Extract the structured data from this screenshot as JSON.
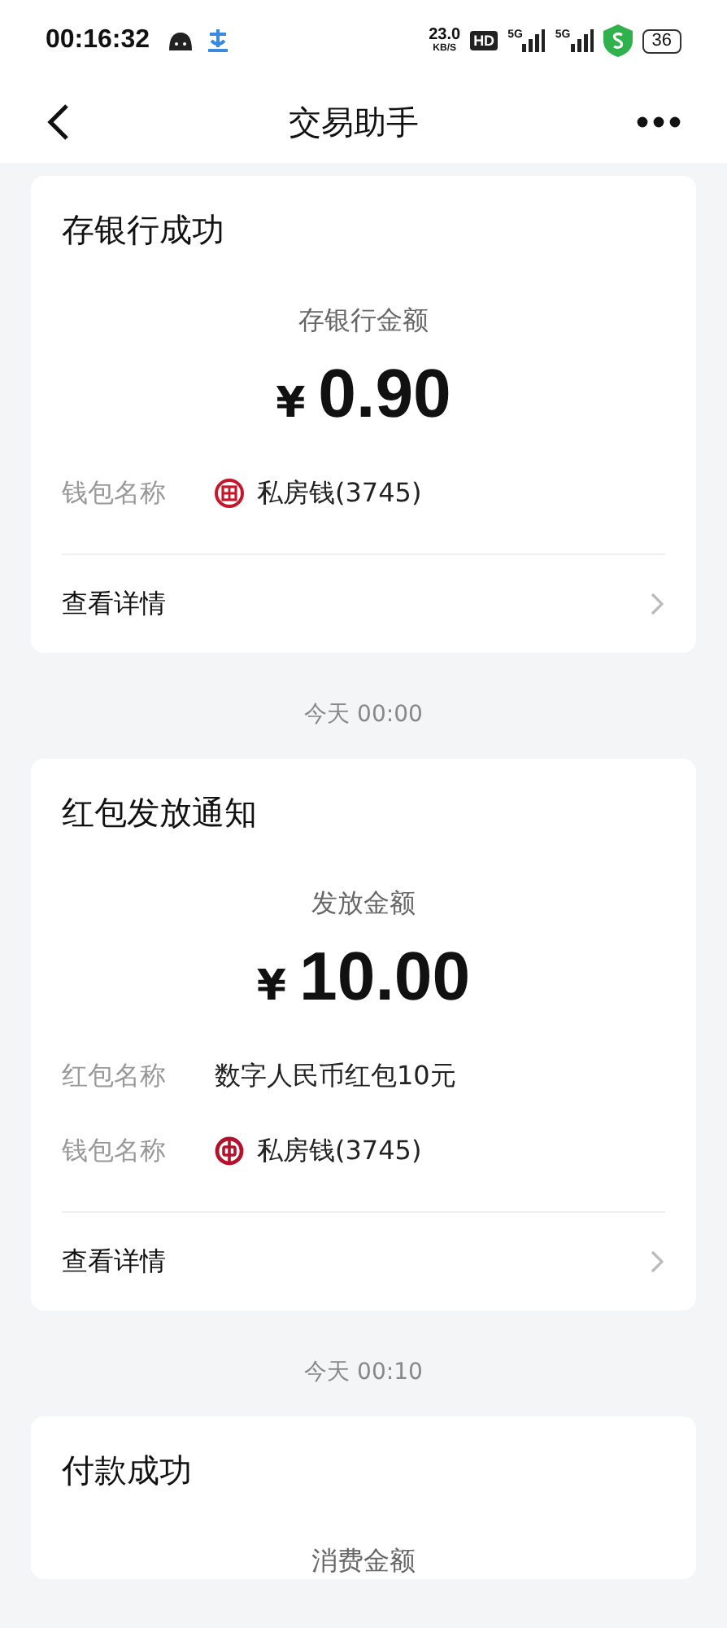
{
  "status_bar": {
    "time": "00:16:32",
    "speed": "23.0",
    "speed_unit": "KB/S",
    "hd": "HD",
    "network_1": "5G",
    "network_2": "5G",
    "battery": "36"
  },
  "nav": {
    "title": "交易助手"
  },
  "messages": [
    {
      "title": "存银行成功",
      "amount_label": "存银行金额",
      "currency": "¥",
      "amount": "0.90",
      "rows": [
        {
          "kind": "squaremark",
          "label": "钱包名称",
          "value": "私房钱(3745)"
        }
      ],
      "details": "查看详情"
    },
    {
      "time": "今天 00:00",
      "title": "红包发放通知",
      "amount_label": "发放金额",
      "currency": "¥",
      "amount": "10.00",
      "rows": [
        {
          "kind": "plain",
          "label": "红包名称",
          "value": "数字人民币红包10元"
        },
        {
          "kind": "roundmark",
          "label": "钱包名称",
          "value": "私房钱(3745)"
        }
      ],
      "details": "查看详情"
    },
    {
      "time": "今天 00:10",
      "title": "付款成功",
      "amount_label": "消费金额"
    }
  ]
}
